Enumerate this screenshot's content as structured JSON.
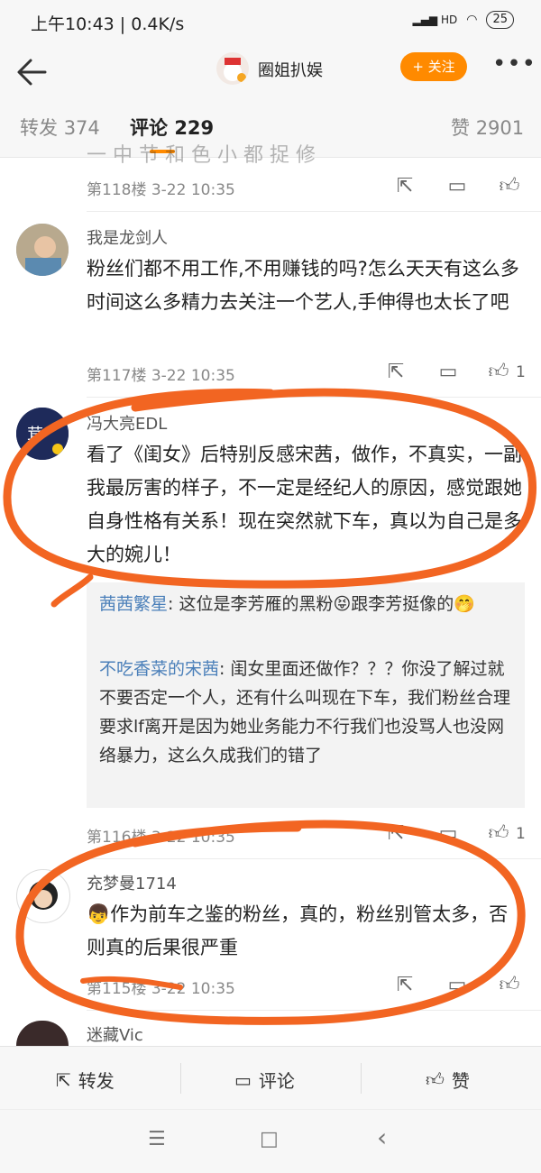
{
  "status_bar": {
    "time": "上午10:43 | 0.4K/s",
    "battery": "25",
    "signal": "HD"
  },
  "header": {
    "account_name": "圈姐扒娱",
    "follow_label": "+ 关注",
    "more": "•••"
  },
  "tabs": [
    {
      "label": "转发",
      "count": "374"
    },
    {
      "label": "评论",
      "count": "229"
    },
    {
      "label": "赞",
      "count": "2901"
    }
  ],
  "comments": [
    {
      "floor": "第118楼",
      "time": "3-22 10:35",
      "partial_text": "一 中 节 和 色 小 都 捉 修",
      "likes": ""
    },
    {
      "username": "我是龙剑人",
      "text": "粉丝们都不用工作,不用赚钱的吗?怎么天天有这么多时间这么多精力去关注一个艺人,手伸得也太长了吧",
      "floor": "第117楼",
      "time": "3-22 10:35",
      "likes": "1"
    },
    {
      "username": "冯大亮EDL",
      "text": "看了《闺女》后特别反感宋茜，做作，不真实，一副我最厉害的样子，不一定是经纪人的原因，感觉跟她自身性格有关系！现在突然就下车，真以为自己是多大的婉儿！",
      "replies": [
        {
          "name": "茜茜繁星",
          "text": ": 这位是李芳雁的黑粉😝跟李芳挺像的🤭"
        },
        {
          "name": "不吃香菜的宋茜",
          "text": ": 闺女里面还做作？？？你没了解过就不要否定一个人，还有什么叫现在下车，我们粉丝合理要求lf离开是因为她业务能力不行我们也没骂人也没网络暴力，这么久成我们的错了"
        }
      ],
      "floor": "第116楼",
      "time": "3-22 10:35",
      "likes": "1"
    },
    {
      "username": "充梦曼1714",
      "text": "👦作为前车之鉴的粉丝，真的，粉丝别管太多，否则真的后果很严重",
      "floor": "第115楼",
      "time": "3-22 10:35",
      "likes": ""
    },
    {
      "username": "迷藏Vic"
    }
  ],
  "bottom_bar": {
    "repost": "转发",
    "comment": "评论",
    "like": "赞"
  },
  "nav_bar": {
    "menu": "☰",
    "home": "□",
    "back": "‹"
  },
  "colors": {
    "accent": "#ff8a00",
    "annotation": "#f26522",
    "link": "#4a7fb9"
  }
}
